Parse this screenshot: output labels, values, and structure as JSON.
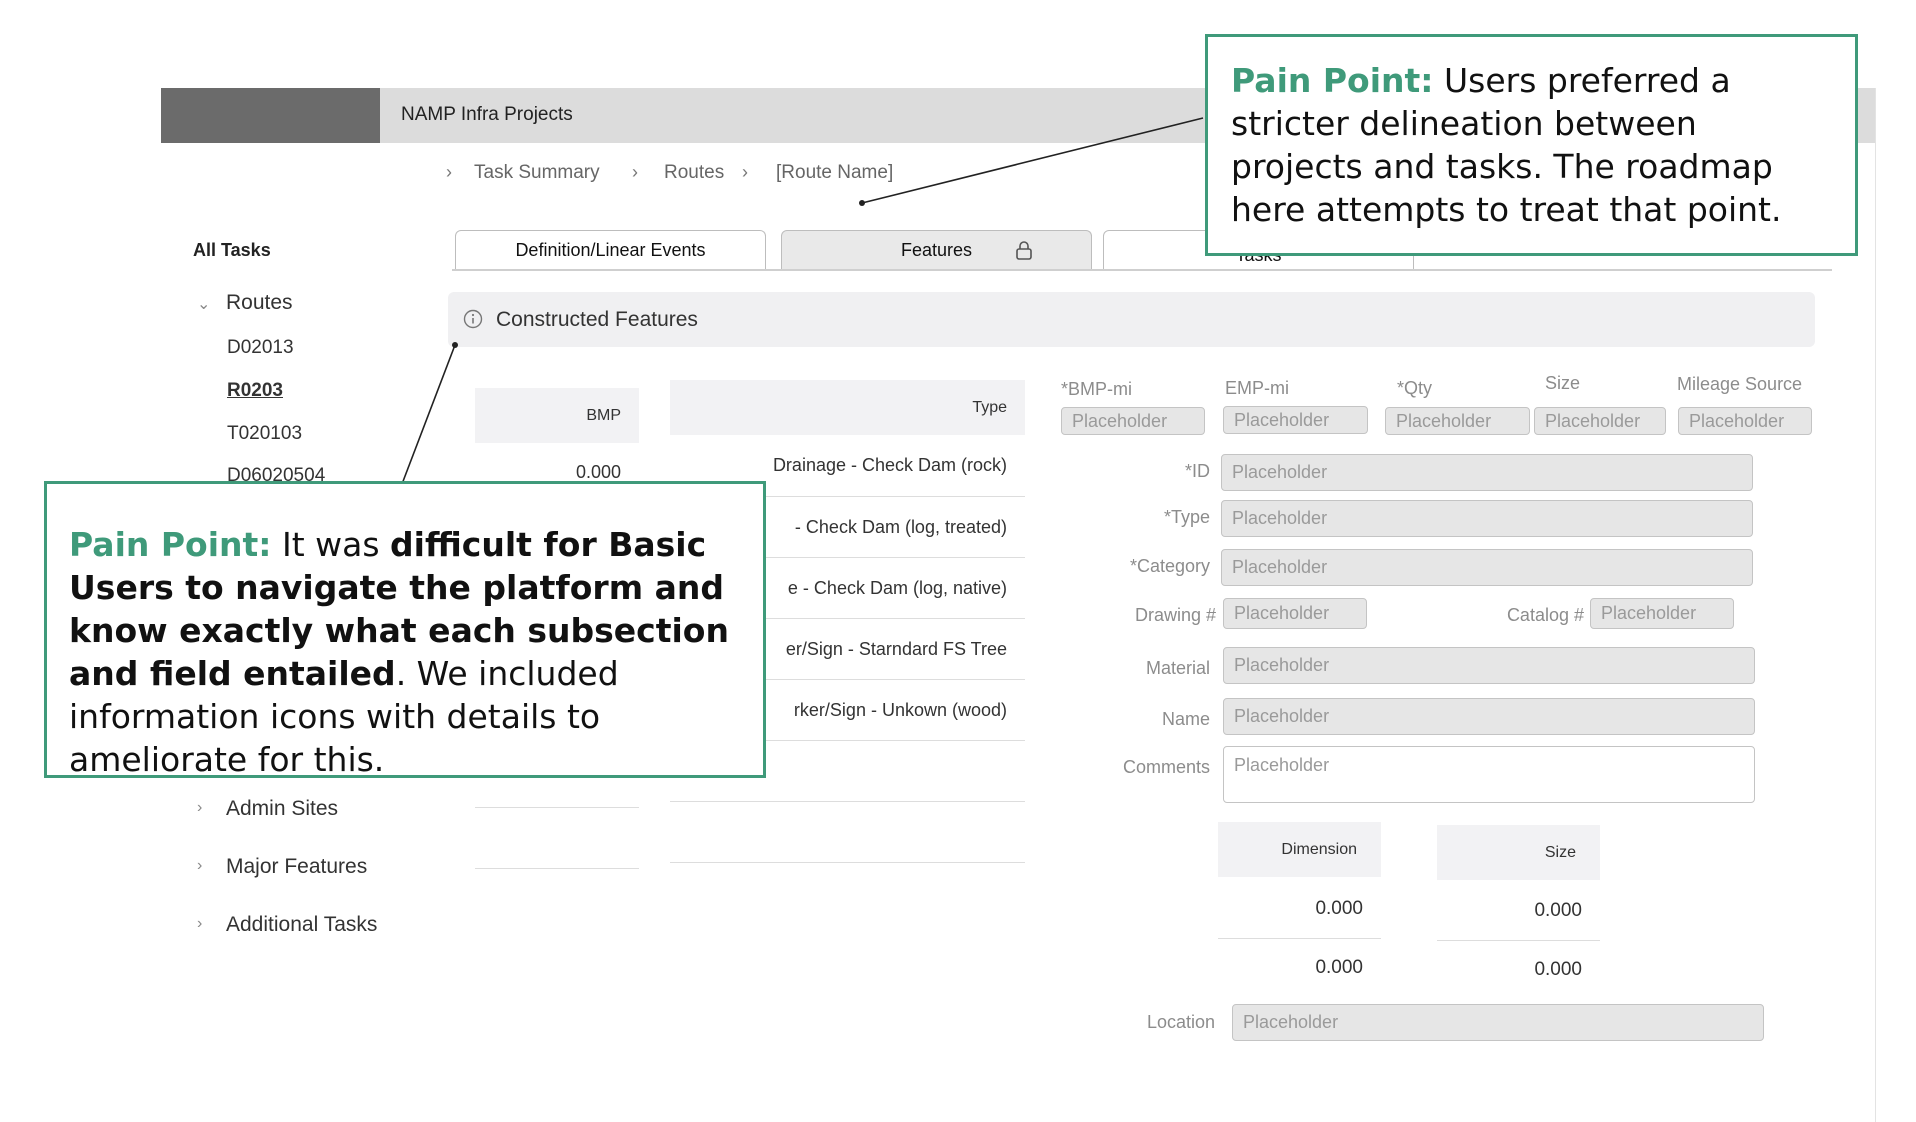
{
  "header": {
    "app_title": "NAMP Infra Projects"
  },
  "breadcrumb": {
    "items": [
      "Task Summary",
      "Routes",
      "[Route Name]"
    ]
  },
  "sidebar": {
    "heading": "All Tasks",
    "routes_label": "Routes",
    "route_items": [
      "D02013",
      "R0203",
      "T020103",
      "D06020504"
    ],
    "groups": [
      "Admin Sites",
      "Major Features",
      "Additional Tasks"
    ]
  },
  "tabs": {
    "definition": "Definition/Linear Events",
    "features": "Features",
    "tasks": "Tasks"
  },
  "section": {
    "title": "Constructed Features"
  },
  "table": {
    "bmp_header": "BMP",
    "type_header": "Type",
    "bmp_value": "0.000",
    "types": [
      "Drainage - Check Dam (rock)",
      "- Check Dam (log, treated)",
      "e - Check Dam (log, native)",
      "er/Sign - Starndard FS Tree",
      "rker/Sign - Unkown (wood)"
    ]
  },
  "form": {
    "top_labels": [
      "*BMP-mi",
      "EMP-mi",
      "*Qty",
      "Size",
      "Mileage Source"
    ],
    "placeholder": "Placeholder",
    "id_label": "*ID",
    "type_label": "*Type",
    "category_label": "*Category",
    "drawing_label": "Drawing #",
    "catalog_label": "Catalog #",
    "material_label": "Material",
    "name_label": "Name",
    "comments_label": "Comments",
    "location_label": "Location"
  },
  "dimension_table": {
    "dimension_header": "Dimension",
    "size_header": "Size",
    "dimension_values": [
      "0.000",
      "0.000"
    ],
    "size_values": [
      "0.000",
      "0.000"
    ]
  },
  "callouts": {
    "top": {
      "lead": "Pain Point:",
      "text": " Users preferred a stricter delineation between projects and tasks. The roadmap here attempts to treat that point."
    },
    "bottom": {
      "lead": "Pain Point:",
      "text1": " It was ",
      "bold1": "difficult for Basic Users to navigate the platform and know exactly what each subsection and field entailed",
      "text2": ". We included information icons with details to ameliorate for this."
    }
  },
  "colors": {
    "accent": "#3f9a7a",
    "header_dark": "#6b6b6b",
    "header_bar": "#dcdcdc"
  }
}
